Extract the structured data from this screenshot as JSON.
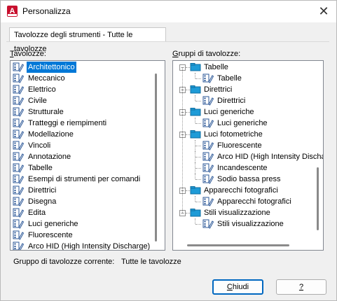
{
  "window": {
    "title": "Personalizza",
    "close_glyph": "✕"
  },
  "tab": {
    "label": "Tavolozze degli strumenti - Tutte le tavolozze"
  },
  "left": {
    "label_prefix": "T",
    "label_rest": "avolozze:",
    "items": [
      "Architettonico",
      "Meccanico",
      "Elettrico",
      "Civile",
      "Strutturale",
      "Tratteggi e riempimenti",
      "Modellazione",
      "Vincoli",
      "Annotazione",
      "Tabelle",
      "Esempi di strumenti per comandi",
      "Direttrici",
      "Disegna",
      "Edita",
      "Luci generiche",
      "Fluorescente",
      "Arco HID (High Intensity Discharge)"
    ],
    "selected_index": 0
  },
  "right": {
    "label_prefix": "G",
    "label_rest": "ruppi di tavolozze:",
    "tree": [
      {
        "label": "Tabelle",
        "level": 0
      },
      {
        "label": "Tabelle",
        "level": 1
      },
      {
        "label": "Direttrici",
        "level": 0
      },
      {
        "label": "Direttrici",
        "level": 1
      },
      {
        "label": "Luci generiche",
        "level": 0
      },
      {
        "label": "Luci generiche",
        "level": 1
      },
      {
        "label": "Luci fotometriche",
        "level": 0
      },
      {
        "label": "Fluorescente",
        "level": 1
      },
      {
        "label": "Arco HID (High Intensity Discharge)",
        "level": 1
      },
      {
        "label": "Incandescente",
        "level": 1
      },
      {
        "label": "Sodio bassa press",
        "level": 1
      },
      {
        "label": "Apparecchi fotografici",
        "level": 0
      },
      {
        "label": "Apparecchi fotografici",
        "level": 1
      },
      {
        "label": "Stili visualizzazione",
        "level": 0
      },
      {
        "label": "Stili visualizzazione",
        "level": 1
      }
    ]
  },
  "current_group": {
    "label": "Gruppo di tavolozze corrente:",
    "value": "Tutte le tavolozze"
  },
  "buttons": {
    "close_prefix": "C",
    "close_rest": "hiudi",
    "help_label": "?"
  },
  "colors": {
    "accent": "#0078d7",
    "app_icon": "#c8102e",
    "folder": "#1e9bd7"
  }
}
